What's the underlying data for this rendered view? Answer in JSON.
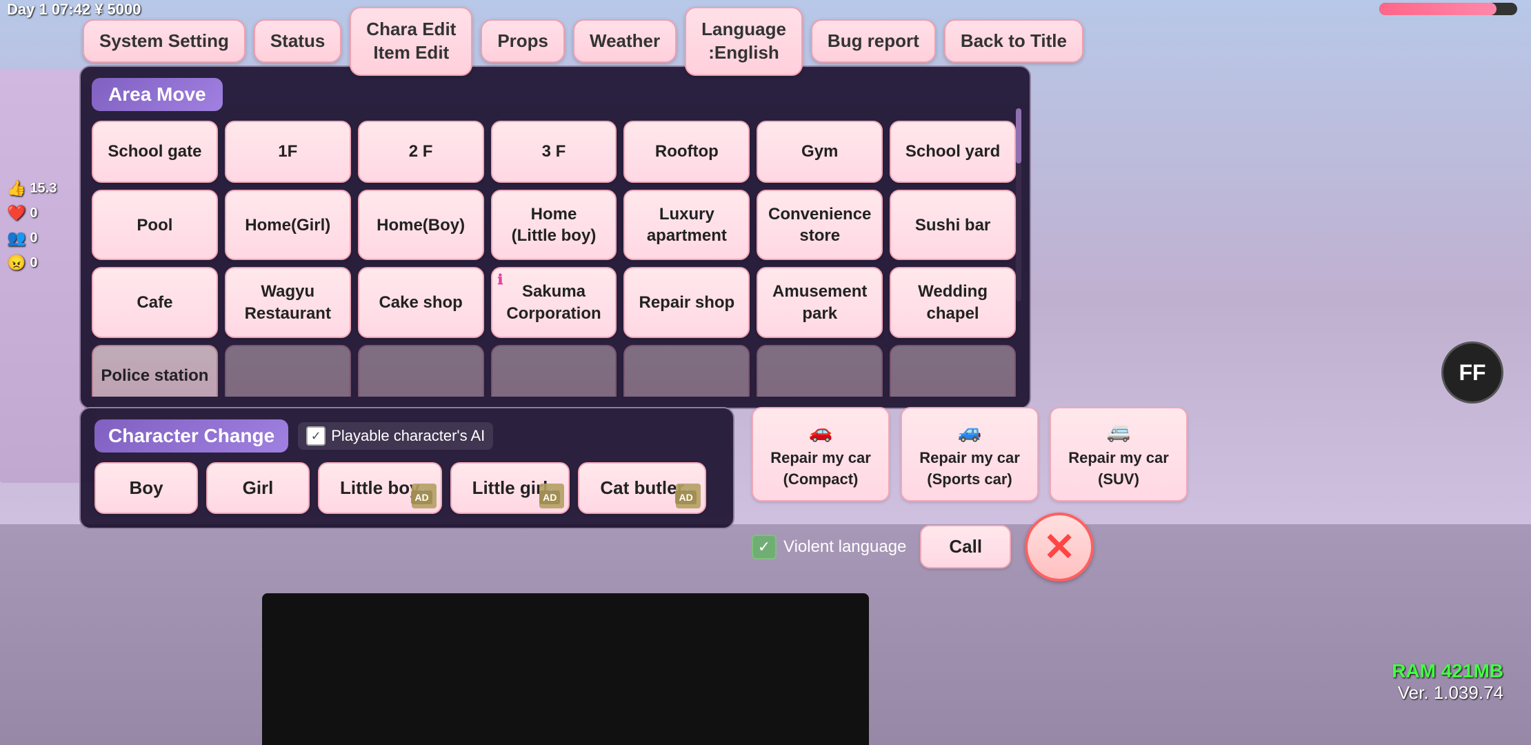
{
  "statusBar": {
    "dayTime": "Day 1  07:42  ¥ 5000",
    "healthBarWidth": "85%"
  },
  "topMenu": {
    "buttons": [
      {
        "id": "system-setting",
        "label": "System Setting"
      },
      {
        "id": "status",
        "label": "Status"
      },
      {
        "id": "chara-edit",
        "label": "Chara Edit\nItem Edit"
      },
      {
        "id": "props",
        "label": "Props"
      },
      {
        "id": "weather",
        "label": "Weather"
      },
      {
        "id": "language",
        "label": "Language\n:English"
      },
      {
        "id": "bug-report",
        "label": "Bug report"
      },
      {
        "id": "back-to-title",
        "label": "Back to Title"
      }
    ]
  },
  "areaMove": {
    "title": "Area Move",
    "locations": [
      {
        "id": "school-gate",
        "label": "School gate",
        "hasMarker": false
      },
      {
        "id": "1f",
        "label": "1F",
        "hasMarker": false
      },
      {
        "id": "2f",
        "label": "2 F",
        "hasMarker": false
      },
      {
        "id": "3f",
        "label": "3 F",
        "hasMarker": false
      },
      {
        "id": "rooftop",
        "label": "Rooftop",
        "hasMarker": false
      },
      {
        "id": "gym",
        "label": "Gym",
        "hasMarker": false
      },
      {
        "id": "school-yard",
        "label": "School yard",
        "hasMarker": false
      },
      {
        "id": "pool",
        "label": "Pool",
        "hasMarker": false
      },
      {
        "id": "home-girl",
        "label": "Home(Girl)",
        "hasMarker": false
      },
      {
        "id": "home-boy",
        "label": "Home(Boy)",
        "hasMarker": false
      },
      {
        "id": "home-little-boy",
        "label": "Home\n(Little boy)",
        "hasMarker": false
      },
      {
        "id": "luxury-apartment",
        "label": "Luxury\napartment",
        "hasMarker": false
      },
      {
        "id": "convenience-store",
        "label": "Convenience\nstore",
        "hasMarker": false
      },
      {
        "id": "sushi-bar",
        "label": "Sushi bar",
        "hasMarker": false
      },
      {
        "id": "cafe",
        "label": "Cafe",
        "hasMarker": false
      },
      {
        "id": "wagyu-restaurant",
        "label": "Wagyu\nRestaurant",
        "hasMarker": false
      },
      {
        "id": "cake-shop",
        "label": "Cake shop",
        "hasMarker": false
      },
      {
        "id": "sakuma-corporation",
        "label": "Sakuma\nCorporation",
        "hasMarker": true
      },
      {
        "id": "repair-shop",
        "label": "Repair shop",
        "hasMarker": false
      },
      {
        "id": "amusement-park",
        "label": "Amusement\npark",
        "hasMarker": false
      },
      {
        "id": "wedding-chapel",
        "label": "Wedding\nchapel",
        "hasMarker": false
      },
      {
        "id": "police-station",
        "label": "Police station",
        "hasMarker": false
      },
      {
        "id": "row4-2",
        "label": "",
        "hasMarker": false
      },
      {
        "id": "row4-3",
        "label": "",
        "hasMarker": false
      },
      {
        "id": "row4-4",
        "label": "",
        "hasMarker": false
      },
      {
        "id": "row4-5",
        "label": "",
        "hasMarker": false
      },
      {
        "id": "row4-6",
        "label": "",
        "hasMarker": false
      },
      {
        "id": "row4-7",
        "label": "",
        "hasMarker": false
      }
    ]
  },
  "characterChange": {
    "title": "Character Change",
    "aiLabel": "Playable character's AI",
    "aiChecked": true,
    "characters": [
      {
        "id": "boy",
        "label": "Boy",
        "locked": false
      },
      {
        "id": "girl",
        "label": "Girl",
        "locked": false
      },
      {
        "id": "little-boy",
        "label": "Little boy",
        "locked": true,
        "ad": true
      },
      {
        "id": "little-girl",
        "label": "Little girl",
        "locked": true,
        "ad": true
      },
      {
        "id": "cat-butler",
        "label": "Cat butler",
        "locked": true,
        "ad": true
      }
    ]
  },
  "carRepair": {
    "buttons": [
      {
        "id": "compact",
        "label": "Repair my car\n(Compact)",
        "color": "car-compact"
      },
      {
        "id": "sports",
        "label": "Repair my car\n(Sports car)",
        "color": "car-sports"
      },
      {
        "id": "suv",
        "label": "Repair my car\n(SUV)",
        "color": "car-suv"
      }
    ]
  },
  "options": {
    "violentLanguageLabel": "Violent language",
    "violentChecked": true,
    "callLabel": "Call"
  },
  "ffAvatar": "FF",
  "info": {
    "ram": "RAM 421MB",
    "version": "Ver. 1.039.74"
  },
  "sideStats": [
    {
      "icon": "👍",
      "value": "15.3"
    },
    {
      "icon": "❤️",
      "value": "0"
    },
    {
      "icon": "👥",
      "value": "0"
    },
    {
      "icon": "😠",
      "value": "0"
    }
  ]
}
